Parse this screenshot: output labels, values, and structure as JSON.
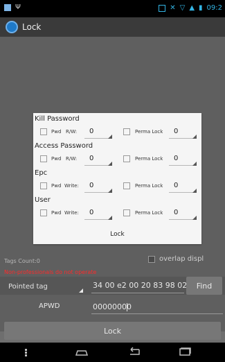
{
  "statusbar": {
    "time": "09:2"
  },
  "actionbar": {
    "title": "Lock"
  },
  "background": {
    "tags_count": "Tags Count:0",
    "overlap_label": "overlap displ",
    "warning": "Non-professionals do not operate",
    "pointed_tag": "Pointed tag",
    "hex_value": "34 00 e2 00 20 83 98 02",
    "find_button": "Find",
    "apwd_label": "APWD",
    "apwd_value": "00000000",
    "lock_button": "Lock"
  },
  "dialog": {
    "sections": [
      {
        "title": "Kill Password",
        "pwd_label": "Pwd",
        "mode_label": "R/W:",
        "mode_value": "0",
        "perma_label": "Perma Lock",
        "perma_value": "0"
      },
      {
        "title": "Access Password",
        "pwd_label": "Pwd",
        "mode_label": "R/W:",
        "mode_value": "0",
        "perma_label": "Perma Lock",
        "perma_value": "0"
      },
      {
        "title": "Epc",
        "pwd_label": "Pwd",
        "mode_label": "Write:",
        "mode_value": "0",
        "perma_label": "Perma Lock",
        "perma_value": "0"
      },
      {
        "title": "User",
        "pwd_label": "Pwd",
        "mode_label": "Write:",
        "mode_value": "0",
        "perma_label": "Perma Lock",
        "perma_value": "0"
      }
    ],
    "lock_button": "Lock"
  },
  "colors": {
    "accent": "#33b5e5",
    "warning": "#ff2a2a",
    "dialog_bg": "#f5f5f5",
    "dim": "#5f5f5f"
  }
}
